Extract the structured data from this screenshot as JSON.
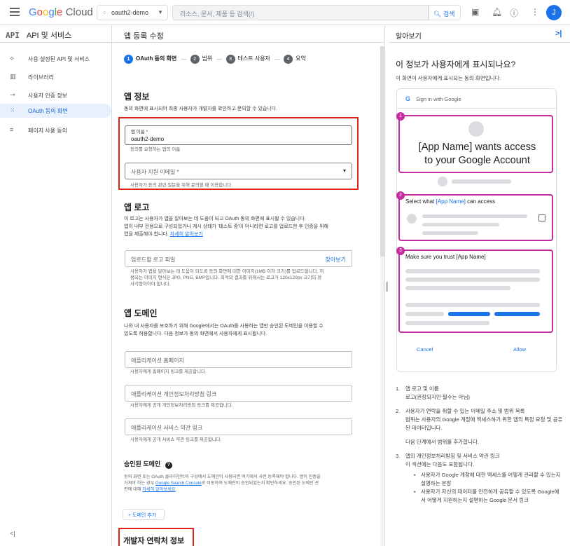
{
  "topbar": {
    "logo_parts": [
      "G",
      "o",
      "o",
      "g",
      "l",
      "e"
    ],
    "logo_suffix": "Cloud",
    "project": "oauth2-demo",
    "search_placeholder": "리소스, 문서, 제품 등 검색(/)",
    "search_button": "검색",
    "avatar_initial": "J"
  },
  "leftnav": {
    "api_label": "API",
    "title": "API 및 서비스",
    "items": [
      {
        "label": "사용 설정된 API 및 서비스",
        "icon": "api-icon"
      },
      {
        "label": "라이브러리",
        "icon": "library-icon"
      },
      {
        "label": "사용자 인증 정보",
        "icon": "key-icon"
      },
      {
        "label": "OAuth 동의 화면",
        "icon": "consent-icon"
      },
      {
        "label": "페이지 사용 동의",
        "icon": "settings-icon"
      }
    ],
    "collapse": "<|"
  },
  "main": {
    "title": "앱 등록 수정",
    "steps": [
      {
        "num": "1",
        "label": "OAuth 동의 화면"
      },
      {
        "num": "2",
        "label": "범위"
      },
      {
        "num": "3",
        "label": "테스트 사용자"
      },
      {
        "num": "4",
        "label": "요약"
      }
    ],
    "app_info": {
      "heading": "앱 정보",
      "desc": "동의 화면에 표시되어 최종 사용자가 개발자를 확인하고 문의할 수 있습니다.",
      "name_label": "앱 이름 *",
      "name_value": "oauth2-demo",
      "name_hint": "동의를 요청하는 앱의 이름",
      "email_label": "사용자 지원 이메일 *",
      "email_hint": "사용자가 동의 관련 질문을 위해 문의할 때 이용합니다."
    },
    "logo": {
      "heading": "앱 로고",
      "desc": "이 로고는 사용자가 앱을 알아보는 데 도움이 되고 OAuth 동의 화면에 표시될 수 있습니다.",
      "desc2": "앱이 내부 전용으로 구성되었거나 게시 상태가 '테스트 중'이 아니라면 로고를 업로드한 후 인증을 위해",
      "desc3": "앱을 제출해야 합니다.",
      "more_link": "자세히 알아보기",
      "upload_placeholder": "업로드할 로고 파일",
      "browse": "찾아보기",
      "hint1": "사용자가 앱을 알아보는 데 도움이 되도록 동의 화면에 대한 이미지(1MB 이하 크기)를 업로드합니다. 허",
      "hint2": "용되는 이미지 형식은 JPG, PNG, BMP입니다. 최적의 결과를 위해서는 로고가 120x120px 크기의 정",
      "hint3": "사각형이어야 합니다."
    },
    "domain": {
      "heading": "앱 도메인",
      "desc": "나와 내 사용자를 보호하기 위해 Google에서는 OAuth를 사용하는 앱만 승인된 도메인을 이용할 수",
      "desc2": "있도록 허용합니다. 다음 정보가 동의 화면에서 사용자에게 표시됩니다.",
      "homepage_placeholder": "애플리케이션 홈페이지",
      "homepage_hint": "사용자에게 홈페이지 링크를 제공합니다.",
      "privacy_placeholder": "애플리케이션 개인정보처리방침 링크",
      "privacy_hint": "사용자에게 공개 개인정보처리방침 링크를 제공합니다.",
      "tos_placeholder": "애플리케이션 서비스 약관 링크",
      "tos_hint": "사용자에게 공개 서비스 약관 링크를 제공합니다."
    },
    "authorized": {
      "heading": "승인된 도메인",
      "desc1": "동의 화면 또는 OAuth 클라이언트의 구성에서 도메인이 사용되면 여기에서 사전 등록해야 합니다. 앱이 인증을",
      "desc2_pre": "거쳐야 하는 경우",
      "search_console": "Google Search Console",
      "desc2_post": "로 이동하여 도메인이 승인되었는지 확인하세요. 승인된 도메인 관",
      "desc3_pre": "련에 대해",
      "more_link": "자세히 알아보세요",
      "add_button": "도메인 추가"
    },
    "developer_heading": "개발자 연락처 정보"
  },
  "right": {
    "title": "알아보기",
    "close": ">|",
    "heading": "이 정보가 사용자에게 표시되나요?",
    "sub": "이 화면이 사용자에게 표시되는 동의 화면입니다.",
    "card": {
      "signin": "Sign in with Google",
      "big_line1": "[App Name] wants access",
      "big_line2": "to your Google Account",
      "select_pre": "Select what",
      "app_name": "[App Name]",
      "select_post": "can access",
      "trust": "Make sure you trust [App Name]",
      "cancel": "Cancel",
      "allow": "Allow",
      "markers": [
        "1",
        "2",
        "3"
      ]
    },
    "notes": [
      {
        "n": "1.",
        "title": "앱 로고 및 이름",
        "body": "로고(권장되지만 필수는 아님)"
      },
      {
        "n": "2.",
        "title": "사용자가 연락을 취할 수 있는 이메일 주소 및 범위 목록",
        "body": "범위는 사용자의 Google 계정에 액세스하기 위한 앱의 특정 요청 및 공유된 데이터입니다.",
        "extra": "다음 단계에서 범위를 추가합니다."
      },
      {
        "n": "3.",
        "title": "앱의 개인정보처리방침 및 서비스 약관 링크",
        "body": "이 섹션에는 다음도 포함됩니다.",
        "bullets": [
          "사용자가 Google 계정에 대한 액세스를 어떻게 관리할 수 있는지 설명하는 문장",
          "사용자가 자신의 데이터를 안전하게 공유할 수 있도록 Google에서 어떻게 지원하는지 설명하는 Google 문서 링크"
        ]
      }
    ]
  },
  "colors": {
    "accent": "#1a73e8",
    "highlight": "#e02419",
    "magenta": "#c42c9f"
  }
}
